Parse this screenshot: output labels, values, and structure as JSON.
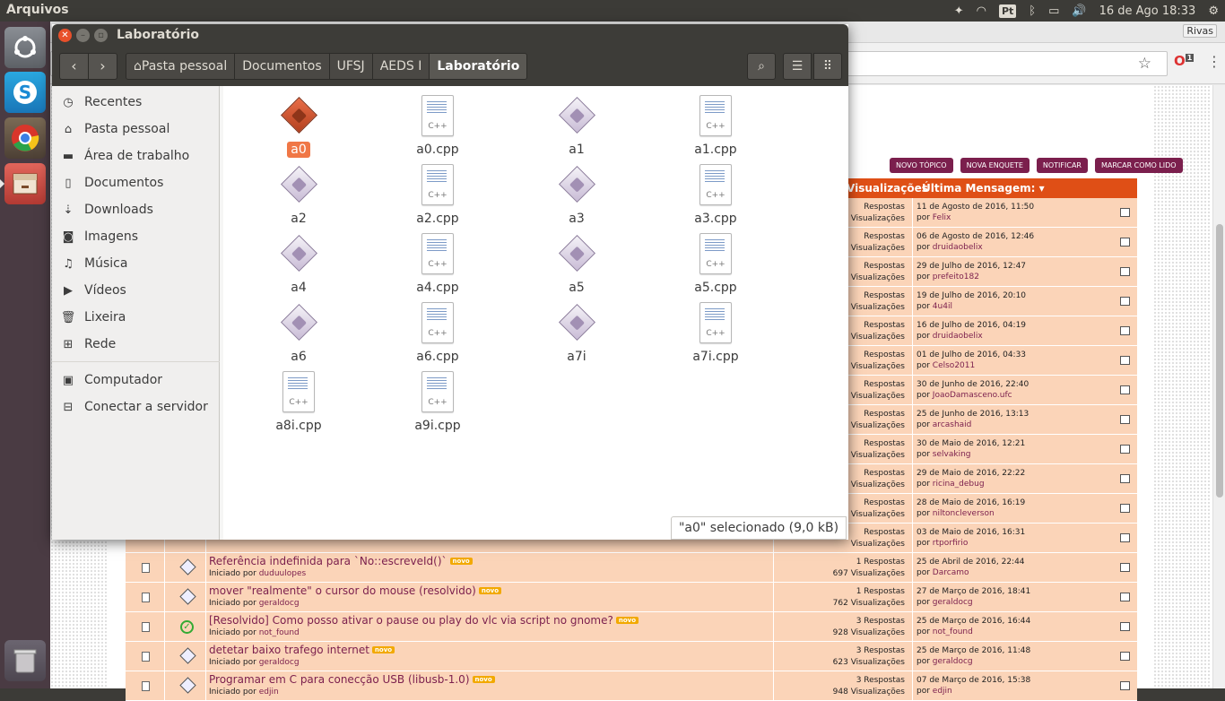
{
  "topbar": {
    "app_title": "Arquivos",
    "lang": "Pt",
    "clock": "16 de Ago 18:33"
  },
  "browser": {
    "user": "Rivas",
    "ext_badge": "1"
  },
  "forum": {
    "buttons": [
      "NOVO TÓPICO",
      "NOVA ENQUETE",
      "NOTIFICAR",
      "MARCAR COMO LIDO"
    ],
    "col_views": "Visualizações",
    "col_last": "Última Mensagem:",
    "by": "por",
    "hidden_rows": [
      {
        "replies": "Respostas",
        "views": "Visualizações",
        "date": "11 de Agosto de 2016, 11:50",
        "user": "Felix"
      },
      {
        "replies": "Respostas",
        "views": "Visualizações",
        "date": "06 de Agosto de 2016, 12:46",
        "user": "druidaobelix"
      },
      {
        "replies": "Respostas",
        "views": "Visualizações",
        "date": "29 de Julho de 2016, 12:47",
        "user": "prefeito182"
      },
      {
        "replies": "Respostas",
        "views": "Visualizações",
        "date": "19 de Julho de 2016, 20:10",
        "user": "4u4il"
      },
      {
        "replies": "Respostas",
        "views": "Visualizações",
        "date": "16 de Julho de 2016, 04:19",
        "user": "druidaobelix"
      },
      {
        "replies": "Respostas",
        "views": "Visualizações",
        "date": "01 de Julho de 2016, 04:33",
        "user": "Celso2011"
      },
      {
        "replies": "Respostas",
        "views": "Visualizações",
        "date": "30 de Junho de 2016, 22:40",
        "user": "JoaoDamasceno.ufc"
      },
      {
        "replies": "Respostas",
        "views": "Visualizações",
        "date": "25 de Junho de 2016, 13:13",
        "user": "arcashaid"
      },
      {
        "replies": "Respostas",
        "views": "Visualizações",
        "date": "30 de Maio de 2016, 12:21",
        "user": "selvaking"
      },
      {
        "replies": "Respostas",
        "views": "Visualizações",
        "date": "29 de Maio de 2016, 22:22",
        "user": "ricina_debug"
      },
      {
        "replies": "Respostas",
        "views": "Visualizações",
        "date": "28 de Maio de 2016, 16:19",
        "user": "niltoncleverson"
      },
      {
        "replies": "Respostas",
        "views": "Visualizações",
        "date": "03 de Maio de 2016, 16:31",
        "user": "rtporfirio"
      }
    ],
    "started_by": "Iniciado por",
    "new_badge": "novo",
    "rows": [
      {
        "title": "Referência indefinida para `No::escreveId()`",
        "author": "duduulopes",
        "replies": "1 Respostas",
        "views": "697 Visualizações",
        "date": "25 de Abril de 2016, 22:44",
        "user": "Darcamo"
      },
      {
        "title": "mover \"realmente\" o cursor do mouse (resolvido)",
        "author": "geraldocg",
        "replies": "1 Respostas",
        "views": "762 Visualizações",
        "date": "27 de Março de 2016, 18:41",
        "user": "geraldocg"
      },
      {
        "title": "[Resolvido] Como posso ativar o pause ou play do vlc via script no gnome?",
        "author": "not_found",
        "replies": "3 Respostas",
        "views": "928 Visualizações",
        "date": "25 de Março de 2016, 16:44",
        "user": "not_found"
      },
      {
        "title": "detetar baixo trafego internet",
        "author": "geraldocg",
        "replies": "3 Respostas",
        "views": "623 Visualizações",
        "date": "25 de Março de 2016, 11:48",
        "user": "geraldocg"
      },
      {
        "title": "Programar em C para conecção USB (libusb-1.0)",
        "author": "edjin",
        "replies": "3 Respostas",
        "views": "948 Visualizações",
        "date": "07 de Março de 2016, 15:38",
        "user": "edjin"
      }
    ]
  },
  "filemanager": {
    "window_title": "Laboratório",
    "breadcrumbs": [
      "Pasta pessoal",
      "Documentos",
      "UFSJ",
      "AEDS I",
      "Laboratório"
    ],
    "sidebar": [
      {
        "label": "Recentes",
        "icon": "clock-icon"
      },
      {
        "label": "Pasta pessoal",
        "icon": "home-icon"
      },
      {
        "label": "Área de trabalho",
        "icon": "folder-icon"
      },
      {
        "label": "Documentos",
        "icon": "document-icon"
      },
      {
        "label": "Downloads",
        "icon": "download-icon"
      },
      {
        "label": "Imagens",
        "icon": "camera-icon"
      },
      {
        "label": "Música",
        "icon": "music-icon"
      },
      {
        "label": "Vídeos",
        "icon": "video-icon"
      },
      {
        "label": "Lixeira",
        "icon": "trash-icon"
      },
      {
        "label": "Rede",
        "icon": "network-icon"
      },
      {
        "label": "Computador",
        "icon": "computer-icon"
      },
      {
        "label": "Conectar a servidor",
        "icon": "server-icon"
      }
    ],
    "files": [
      {
        "name": "a0",
        "type": "exec",
        "selected": true
      },
      {
        "name": "a0.cpp",
        "type": "cpp"
      },
      {
        "name": "a1",
        "type": "exec"
      },
      {
        "name": "a1.cpp",
        "type": "cpp"
      },
      {
        "name": "a2",
        "type": "exec"
      },
      {
        "name": "a2.cpp",
        "type": "cpp"
      },
      {
        "name": "a3",
        "type": "exec"
      },
      {
        "name": "a3.cpp",
        "type": "cpp"
      },
      {
        "name": "a4",
        "type": "exec"
      },
      {
        "name": "a4.cpp",
        "type": "cpp"
      },
      {
        "name": "a5",
        "type": "exec"
      },
      {
        "name": "a5.cpp",
        "type": "cpp"
      },
      {
        "name": "a6",
        "type": "exec"
      },
      {
        "name": "a6.cpp",
        "type": "cpp"
      },
      {
        "name": "a7i",
        "type": "exec"
      },
      {
        "name": "a7i.cpp",
        "type": "cpp"
      },
      {
        "name": "a8i.cpp",
        "type": "cpp"
      },
      {
        "name": "a9i.cpp",
        "type": "cpp"
      }
    ],
    "cpp_icon_text": "C++",
    "status": "\"a0\" selecionado  (9,0 kB)"
  }
}
